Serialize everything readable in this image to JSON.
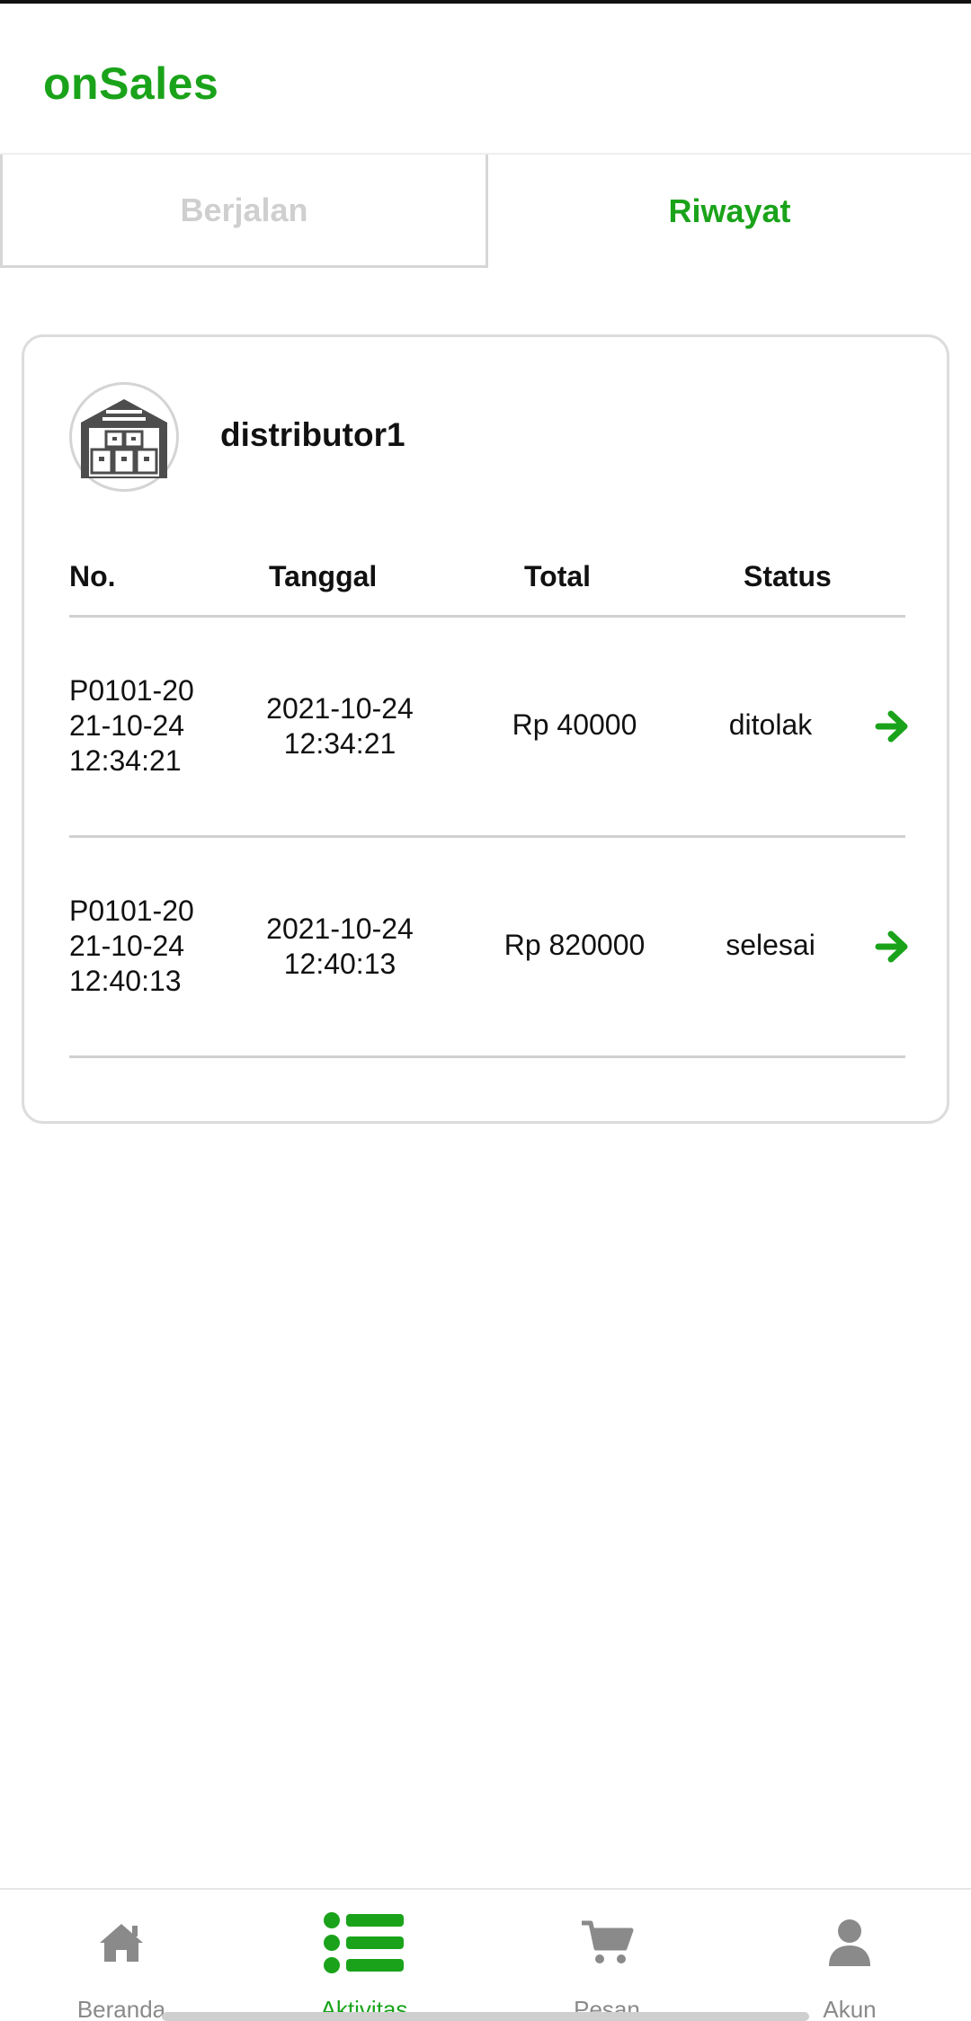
{
  "app": {
    "title": "onSales",
    "brand_color": "#1aa31a"
  },
  "tabs": [
    {
      "label": "Berjalan",
      "active": false
    },
    {
      "label": "Riwayat",
      "active": true
    }
  ],
  "card": {
    "distributor_name": "distributor1",
    "avatar_icon": "warehouse-icon",
    "columns": [
      "No.",
      "Tanggal",
      "Total",
      "Status"
    ],
    "rows": [
      {
        "no": [
          "P0101-20",
          "21-10-24",
          "12:34:21"
        ],
        "date": [
          "2021-10-24",
          "12:34:21"
        ],
        "total": "Rp 40000",
        "status": "ditolak",
        "action_icon": "arrow-right-icon"
      },
      {
        "no": [
          "P0101-20",
          "21-10-24",
          "12:40:13"
        ],
        "date": [
          "2021-10-24",
          "12:40:13"
        ],
        "total": "Rp 820000",
        "status": "selesai",
        "action_icon": "arrow-right-icon"
      }
    ]
  },
  "bottom_nav": [
    {
      "label": "Beranda",
      "icon": "home-icon",
      "active": false
    },
    {
      "label": "Aktivitas",
      "icon": "list-icon",
      "active": true
    },
    {
      "label": "Pesan",
      "icon": "cart-icon",
      "active": false
    },
    {
      "label": "Akun",
      "icon": "user-icon",
      "active": false
    }
  ]
}
